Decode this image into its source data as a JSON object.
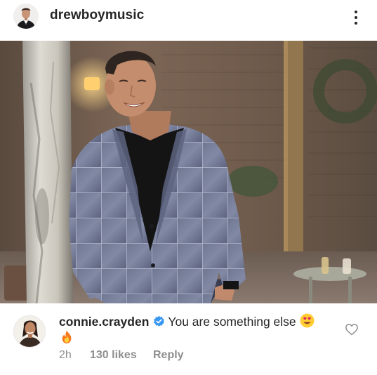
{
  "post": {
    "username": "drewboymusic",
    "more_icon": "more-vertical-icon"
  },
  "comment": {
    "username": "connie.crayden",
    "text": "You are something else",
    "emojis": [
      "heart-eyes-emoji",
      "fire-emoji"
    ],
    "time": "2h",
    "likes": "130 likes",
    "reply_label": "Reply",
    "verified": true,
    "like_icon": "heart-outline-icon"
  },
  "colors": {
    "text": "#262626",
    "muted": "#8e8e8e",
    "verified": "#3897f0"
  }
}
